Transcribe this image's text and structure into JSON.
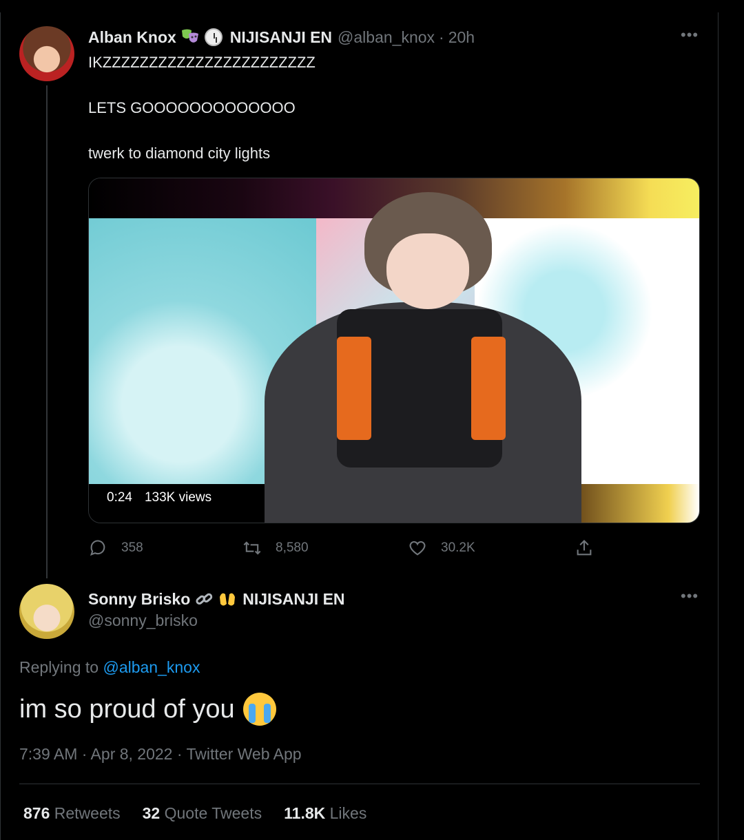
{
  "tweet1": {
    "author": "Alban Knox",
    "org": "NIJISANJI EN",
    "handle": "@alban_knox",
    "time_sep": "·",
    "time": "20h",
    "more_icon": "more-icon",
    "lines": [
      "IKZZZZZZZZZZZZZZZZZZZZZZZ",
      "LETS GOOOOOOOOOOOOO",
      "twerk to diamond city lights"
    ],
    "media": {
      "duration": "0:24",
      "views": "133K views"
    },
    "actions": {
      "reply_count": "358",
      "retweet_count": "8,580",
      "like_count": "30.2K"
    }
  },
  "tweet2": {
    "author": "Sonny Brisko",
    "org": "NIJISANJI EN",
    "handle": "@sonny_brisko",
    "replying_label": "Replying to",
    "replying_to": "@alban_knox",
    "text": "im so proud of you",
    "meta": "7:39 AM · Apr 8, 2022 · Twitter Web App",
    "stats": [
      {
        "num": "876",
        "label": "Retweets"
      },
      {
        "num": "32",
        "label": "Quote Tweets"
      },
      {
        "num": "11.8K",
        "label": "Likes"
      }
    ]
  },
  "colors": {
    "accent": "#1d9bf0",
    "muted": "#71767b",
    "text": "#e7e9ea",
    "background": "#000000"
  }
}
